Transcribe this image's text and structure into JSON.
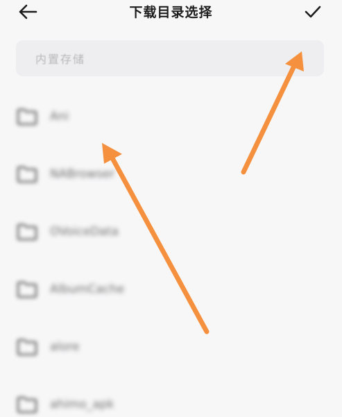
{
  "header": {
    "title": "下载目录选择",
    "back_icon": "arrow-left-icon",
    "confirm_icon": "checkmark-icon"
  },
  "path_bar": {
    "text": "内置存储"
  },
  "folders": [
    {
      "name": "Ani"
    },
    {
      "name": "NABrowser"
    },
    {
      "name": "OVoiceData"
    },
    {
      "name": "AlbumCache"
    },
    {
      "name": "alore"
    },
    {
      "name": "ahimo_apk"
    }
  ],
  "colors": {
    "annotation_arrow": "#f5913e",
    "background": "#f7f7f8",
    "path_bar_bg": "#eeeef0"
  }
}
